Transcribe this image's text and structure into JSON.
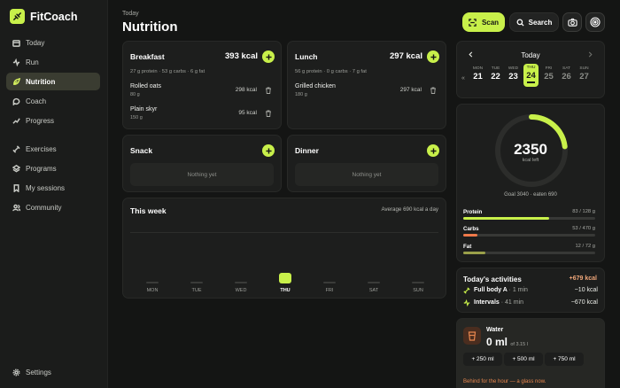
{
  "app": {
    "name": "FitCoach"
  },
  "sidebar": {
    "items": [
      {
        "label": "Today",
        "icon": "calendar-icon"
      },
      {
        "label": "Run",
        "icon": "activity-icon"
      },
      {
        "label": "Nutrition",
        "icon": "leaf-icon",
        "active": true
      },
      {
        "label": "Coach",
        "icon": "chat-icon"
      },
      {
        "label": "Progress",
        "icon": "chart-icon"
      },
      {
        "label": "Exercises",
        "icon": "dumbbell-icon"
      },
      {
        "label": "Programs",
        "icon": "layers-icon"
      },
      {
        "label": "My sessions",
        "icon": "bookmark-icon"
      },
      {
        "label": "Community",
        "icon": "users-icon"
      }
    ],
    "settings_label": "Settings"
  },
  "header": {
    "kicker": "Today",
    "title": "Nutrition",
    "scan_label": "Scan",
    "search_label": "Search"
  },
  "meals": {
    "breakfast": {
      "title": "Breakfast",
      "kcal": "393 kcal",
      "macros": "27 g protein · 53 g carbs · 6 g fat",
      "items": [
        {
          "name": "Rolled oats",
          "qty": "80 g",
          "kcal": "298 kcal"
        },
        {
          "name": "Plain skyr",
          "qty": "150 g",
          "kcal": "95 kcal"
        }
      ]
    },
    "lunch": {
      "title": "Lunch",
      "kcal": "297 kcal",
      "macros": "56 g protein · 0 g carbs · 7 g fat",
      "items": [
        {
          "name": "Grilled chicken",
          "qty": "180 g",
          "kcal": "297 kcal"
        }
      ]
    },
    "snack": {
      "title": "Snack",
      "empty": "Nothing yet"
    },
    "dinner": {
      "title": "Dinner",
      "empty": "Nothing yet"
    }
  },
  "week": {
    "title": "This week",
    "average": "Average 690 kcal a day",
    "days": [
      "MON",
      "TUE",
      "WED",
      "THU",
      "FRI",
      "SAT",
      "SUN"
    ],
    "active_index": 3,
    "values": [
      0,
      0,
      0,
      690,
      0,
      0,
      0
    ]
  },
  "calendar": {
    "label": "Today",
    "days": [
      {
        "name": "MON",
        "date": "21"
      },
      {
        "name": "TUE",
        "date": "22"
      },
      {
        "name": "WED",
        "date": "23"
      },
      {
        "name": "THU",
        "date": "24",
        "selected": true
      },
      {
        "name": "FRI",
        "date": "25"
      },
      {
        "name": "SAT",
        "date": "26"
      },
      {
        "name": "SUN",
        "date": "27"
      }
    ]
  },
  "goal": {
    "kcal_left": "2350",
    "kcal_left_label": "kcal left",
    "summary": "Goal 3040 · eaten 690",
    "progress": 0.23,
    "macros": [
      {
        "name": "Protein",
        "value": "83 / 128 g",
        "fraction": 0.65,
        "color": "#c8f04a"
      },
      {
        "name": "Carbs",
        "value": "53 / 470 g",
        "fraction": 0.11,
        "color": "#f07a4a"
      },
      {
        "name": "Fat",
        "value": "12 / 72 g",
        "fraction": 0.17,
        "color": "#9aa04a"
      }
    ]
  },
  "activities": {
    "title": "Today's activities",
    "total": "+679 kcal",
    "items": [
      {
        "name": "Full body A",
        "duration": "· 1 min",
        "kcal": "~10 kcal",
        "icon": "dumbbell-icon"
      },
      {
        "name": "Intervals",
        "duration": "· 41 min",
        "kcal": "~670 kcal",
        "icon": "activity-icon"
      }
    ]
  },
  "water": {
    "label": "Water",
    "amount": "0 ml",
    "of": "of 3.15 l",
    "buttons": [
      "+ 250 ml",
      "+ 500 ml",
      "+ 750 ml"
    ],
    "warning": "Behind for the hour — a glass now."
  },
  "colors": {
    "accent": "#c8f04a",
    "warning": "#e8874f"
  }
}
